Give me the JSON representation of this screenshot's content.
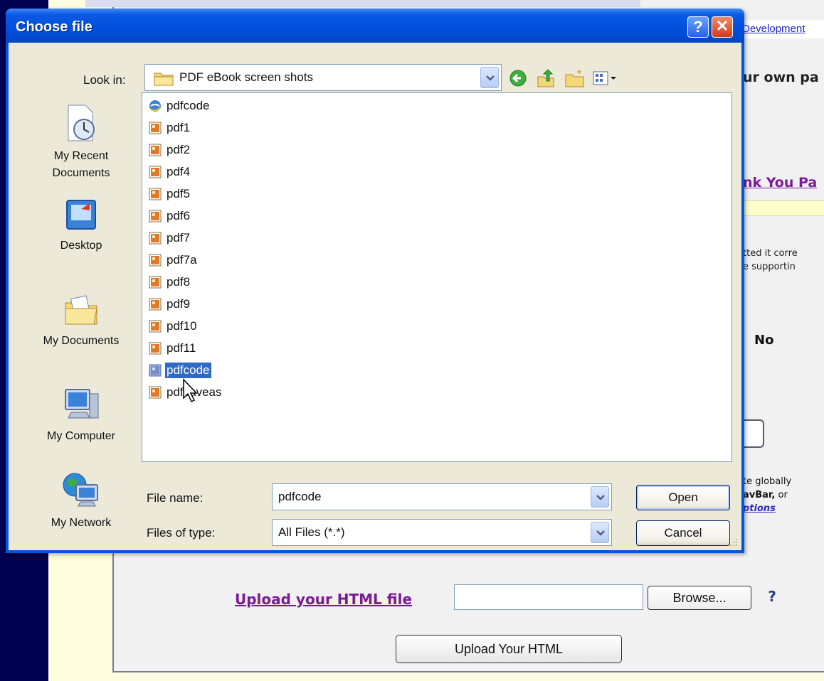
{
  "background": {
    "dev_link": "Development",
    "frag_own_page": "ur own pa",
    "frag_thank_you": "nk You Pa",
    "frag_text1_line1": "tted it corre",
    "frag_text1_line2": "e supportin",
    "frag_no": "No",
    "frag_text2_line1": "te globally",
    "frag_text2_line2_bold": "avBar,",
    "frag_text2_line2_rest": " or",
    "frag_text2_line3": "ptions",
    "upload_label": "Upload your HTML file",
    "browse_label": "Browse...",
    "help_glyph": "?",
    "upload_button_label": "Upload Your HTML"
  },
  "dialog": {
    "title": "Choose file",
    "help_glyph": "?",
    "close_glyph": "✕",
    "look_in_label": "Look in:",
    "look_in_value": "PDF eBook screen shots",
    "places": [
      {
        "label_line1": "My Recent",
        "label_line2": "Documents",
        "icon": "recent-documents-icon"
      },
      {
        "label_line1": "Desktop",
        "label_line2": "",
        "icon": "desktop-icon"
      },
      {
        "label_line1": "My Documents",
        "label_line2": "",
        "icon": "my-documents-icon"
      },
      {
        "label_line1": "My Computer",
        "label_line2": "",
        "icon": "my-computer-icon"
      },
      {
        "label_line1": "My Network",
        "label_line2": "",
        "icon": "my-network-icon"
      }
    ],
    "files": [
      {
        "name": "pdfcode",
        "type": "html"
      },
      {
        "name": "pdf1",
        "type": "image"
      },
      {
        "name": "pdf2",
        "type": "image"
      },
      {
        "name": "pdf4",
        "type": "image"
      },
      {
        "name": "pdf5",
        "type": "image"
      },
      {
        "name": "pdf6",
        "type": "image"
      },
      {
        "name": "pdf7",
        "type": "image"
      },
      {
        "name": "pdf7a",
        "type": "image"
      },
      {
        "name": "pdf8",
        "type": "image"
      },
      {
        "name": "pdf9",
        "type": "image"
      },
      {
        "name": "pdf10",
        "type": "image"
      },
      {
        "name": "pdf11",
        "type": "image"
      },
      {
        "name": "pdfcode",
        "type": "image",
        "selected": true
      },
      {
        "name": "pdfsaveas",
        "type": "image"
      }
    ],
    "file_name_label": "File name:",
    "file_name_value": "pdfcode",
    "file_type_label": "Files of type:",
    "file_type_value": "All Files (*.*)",
    "open_label": "Open",
    "cancel_label": "Cancel"
  },
  "colors": {
    "title_bar": "#0054e3",
    "selection": "#316ac5",
    "dialog_body": "#ece9d8",
    "link_purple": "#7a1a9a",
    "page_navy": "#000050"
  }
}
